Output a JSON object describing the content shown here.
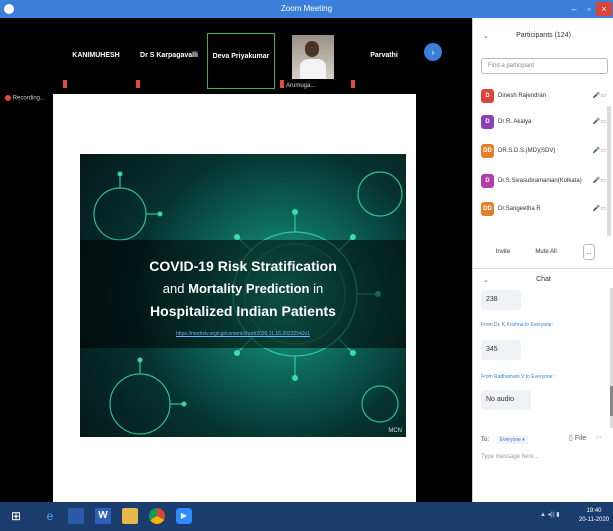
{
  "window": {
    "title": "Zoom Meeting",
    "min": "–",
    "max": "▫",
    "close": "×"
  },
  "video_strip": {
    "tiles": [
      {
        "name": "KANIMUHESH"
      },
      {
        "name": "Dr S Karpagavalli"
      },
      {
        "name": "Deva Priyakumar",
        "active": true
      },
      {
        "name": "",
        "caption": "Arumuga..."
      },
      {
        "name": "Parvathi"
      }
    ],
    "next_icon": "chevron-right-icon"
  },
  "recording": {
    "label": "Recording..."
  },
  "slide": {
    "title_line1": "COVID-19 Risk Stratification",
    "title_line2_bold": "Mortality Prediction",
    "title_line2_pre": "and ",
    "title_line2_post": " in",
    "title_line3": "Hospitalized Indian Patients",
    "link": "https://medrxiv.org/cgi/content/short/2020.11.16.20232542v1",
    "watermark": "MCN"
  },
  "participants": {
    "header": "Participants (124)",
    "search_placeholder": "Find a participant",
    "list": [
      {
        "initial": "D",
        "name": "Dinesh Rajendran",
        "color": "#d9453a"
      },
      {
        "initial": "D",
        "name": "Dr R. Akalya",
        "color": "#8a3fb5"
      },
      {
        "initial": "DD",
        "name": "DR.S.D.S.(MD)(SDV)",
        "color": "#e0802b"
      },
      {
        "initial": "D",
        "name": "Dr.S.Sivasubramanian(Kolkata)",
        "color": "#b43dac"
      },
      {
        "initial": "DD",
        "name": "Dr.Sangeetha R",
        "color": "#e0802b"
      }
    ],
    "invite_label": "Invite",
    "mute_all_label": "Mute All",
    "more_label": "..."
  },
  "chat": {
    "header": "Chat",
    "messages": [
      {
        "from": "",
        "text": "238"
      },
      {
        "from": "From Dr. K.Krishna to Everyone:",
        "text": "345"
      },
      {
        "from": "From Radhamani V to Everyone:",
        "text": "No audio"
      }
    ],
    "to_label": "To:",
    "to_value": "Everyone ▾",
    "file_label": "File",
    "input_placeholder": "Type message here..."
  },
  "taskbar": {
    "clock_time": "19:40",
    "clock_date": "20-11-2020",
    "tray": "▲ ◂)) ▮"
  },
  "colors": {
    "accent": "#3b7fd9",
    "mute": "#e24a3b",
    "taskbar": "#1b3d6e"
  }
}
